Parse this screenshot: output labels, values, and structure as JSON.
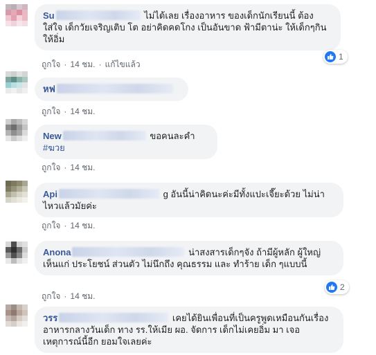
{
  "comments": [
    {
      "author": "Su",
      "text": "ไม่ได้เลย เรื่องอาหาร ของเด็กนักเรียนนี้ ต้องใส่ใจ เด็กวัยเจริญเติบ โต อย่าคิดคดโกง เป็นอันขาด ฟ้ามีตาน่ะ ให้เด็กๆกินให้อิ่ม",
      "like": "ถูกใจ",
      "time": "14 ชม.",
      "edited": "แก้ไขแล้ว",
      "reactions": "1"
    },
    {
      "author": "หฟ",
      "text": "",
      "like": "ถูกใจ",
      "time": "14 ชม."
    },
    {
      "author": "New",
      "text": "ขอคนละคำ",
      "hashtag": "#ฆวย",
      "like": "ถูกใจ",
      "time": "14 ชม."
    },
    {
      "author": "Api",
      "text": "g อันนี้น่าคิดนะค่ะมีทั้งแปะเจี๊ยะด้วย ไม่น่าไหวแล้วมัยค่ะ",
      "like": "ถูกใจ",
      "time": "14 ชม."
    },
    {
      "author": "Anona",
      "text": "น่าสงสารเด็กๆจัง ถ้ามีผู้หลัก ผู้ใหญ่ เห็นแก่ ประโยชน์ ส่วนตัว ไม่นึกถึง คุณธรรม และ ทำร้าย เด็ก ๆแบบนี้",
      "like": "ถูกใจ",
      "time": "14 ชม.",
      "reactions": "2"
    },
    {
      "author": "วรร",
      "text": "เคยได้ยินเพื่อนที่เป็นครูพูดเหมือนกันเรื่อง อาหารกลางวันเด็ก ทาง รร.ให้เมีย ผอ. จัดการ เด็กไม่เคยอิ่ม มา เจอเหตุการณ์นี้อีก ยอมใจเลยค่ะ"
    }
  ],
  "icons": {
    "like_reaction": "thumbs-up-icon"
  },
  "colors": {
    "author": "#385898",
    "bubble": "#f2f3f5",
    "like_blue": "#2078f4",
    "meta": "#606770"
  }
}
